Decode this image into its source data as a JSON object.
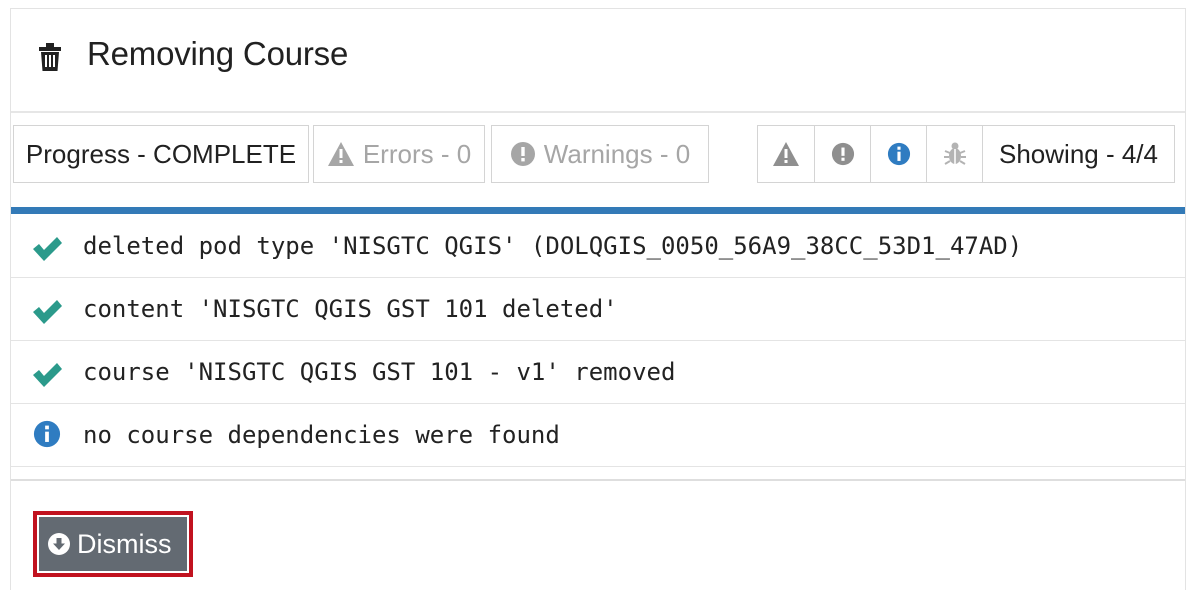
{
  "dialog": {
    "title": "Removing Course",
    "title_icon": "trash-icon"
  },
  "toolbar": {
    "progress_label": "Progress - COMPLETE",
    "errors_label": "Errors - 0",
    "warnings_label": "Warnings - 0",
    "filter_icons": [
      "warning-icon",
      "exclamation-icon",
      "info-icon",
      "bug-icon"
    ],
    "showing_label": "Showing - 4/4"
  },
  "log": [
    {
      "status": "success",
      "icon": "check-icon",
      "message": "deleted pod type 'NISGTC QGIS' (DOLQGIS_0050_56A9_38CC_53D1_47AD)"
    },
    {
      "status": "success",
      "icon": "check-icon",
      "message": "content 'NISGTC QGIS GST 101 deleted'"
    },
    {
      "status": "success",
      "icon": "check-icon",
      "message": "course 'NISGTC QGIS GST 101 - v1' removed"
    },
    {
      "status": "info",
      "icon": "info-icon",
      "message": "no course dependencies were found"
    }
  ],
  "actions": {
    "dismiss_label": "Dismiss",
    "dismiss_icon": "arrow-circle-down-icon"
  },
  "colors": {
    "accent": "#337ab7",
    "success": "#2b9a8b",
    "info": "#2f7cc1",
    "button": "#636a72",
    "highlight": "#c1121f",
    "disabled": "#a6a6a6"
  }
}
